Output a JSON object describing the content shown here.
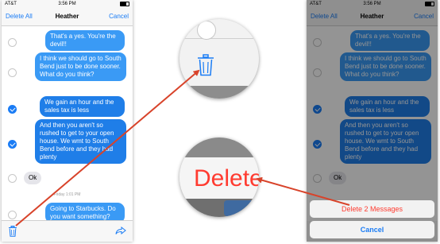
{
  "status_bar": {
    "carrier": "AT&T",
    "time": "3:56 PM"
  },
  "nav": {
    "left_action": "Delete All",
    "title": "Heather",
    "right_action": "Cancel"
  },
  "messages": [
    {
      "text": "That's a yes. You're the devil!!",
      "checked": false
    },
    {
      "text": "I think we should go to South Bend just to be done sooner. What do you think?",
      "checked": false
    },
    {
      "text": "We gain an hour and the sales tax is less",
      "checked": true
    },
    {
      "text": "And then you aren't so rushed to get to your open house. We wmt to South Bend before and they had plenty",
      "checked": true
    },
    {
      "text": "Ok",
      "checked": false
    },
    {
      "text": "Going to Starbucks. Do you want something?",
      "checked": false
    }
  ],
  "timestamp": "Friday 1:01 PM",
  "zoom": {
    "delete_label": "Delete"
  },
  "action_sheet": {
    "destructive_label": "Delete 2 Messages",
    "cancel_label": "Cancel"
  },
  "icons": {
    "trash": "trash-icon",
    "share": "share-icon"
  },
  "colors": {
    "accent": "#1a7cf5",
    "bubble_blue": "#3a9af5",
    "destructive": "#ff3b30",
    "arrow": "#d8432a"
  }
}
